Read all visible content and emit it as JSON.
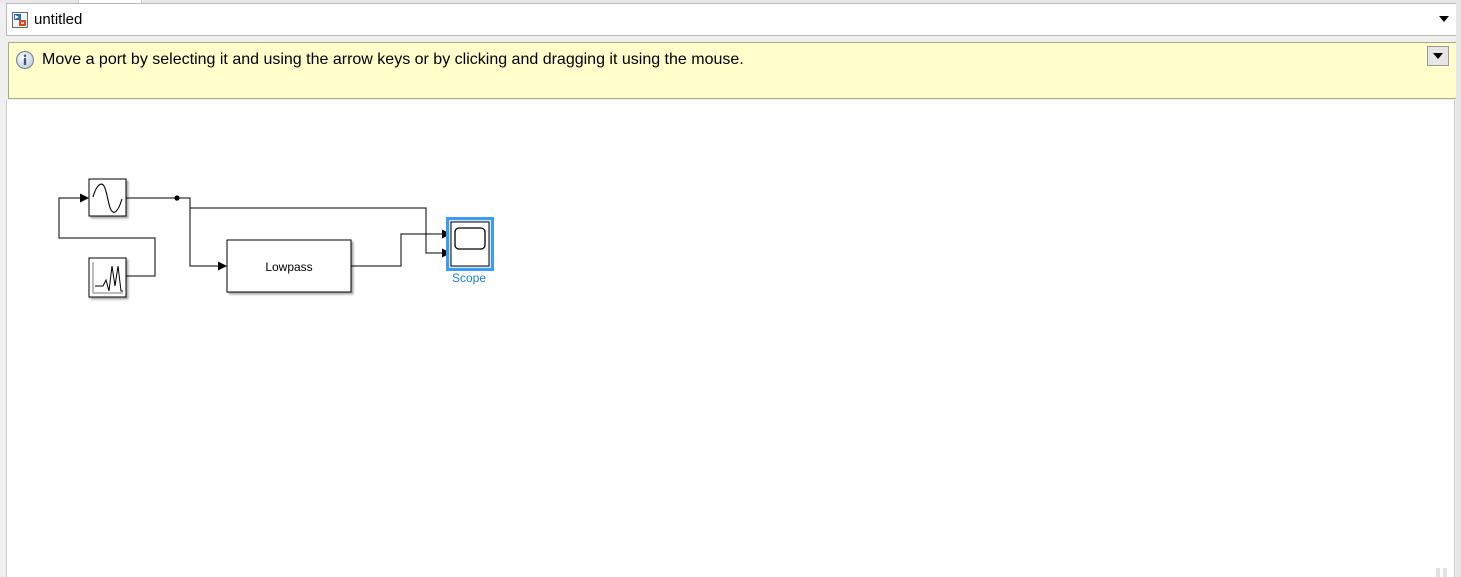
{
  "address_bar": {
    "model_name": "untitled",
    "dropdown_icon": "triangle-down-icon",
    "model_icon": "simulink-model-icon"
  },
  "notification": {
    "icon": "info-icon",
    "message": "Move a port by selecting it and using the arrow keys or by clicking and dragging it using the mouse.",
    "dropdown_icon": "triangle-down-icon",
    "background_color": "#ffffcc"
  },
  "diagram": {
    "blocks": {
      "sine_wave": {
        "icon": "sine-wave-icon"
      },
      "signal_source": {
        "icon": "signal-burst-icon"
      },
      "lowpass": {
        "label": "Lowpass"
      },
      "scope": {
        "label": "Scope",
        "icon": "scope-icon",
        "selected": true
      }
    },
    "selection_color": "#1e90ff"
  }
}
